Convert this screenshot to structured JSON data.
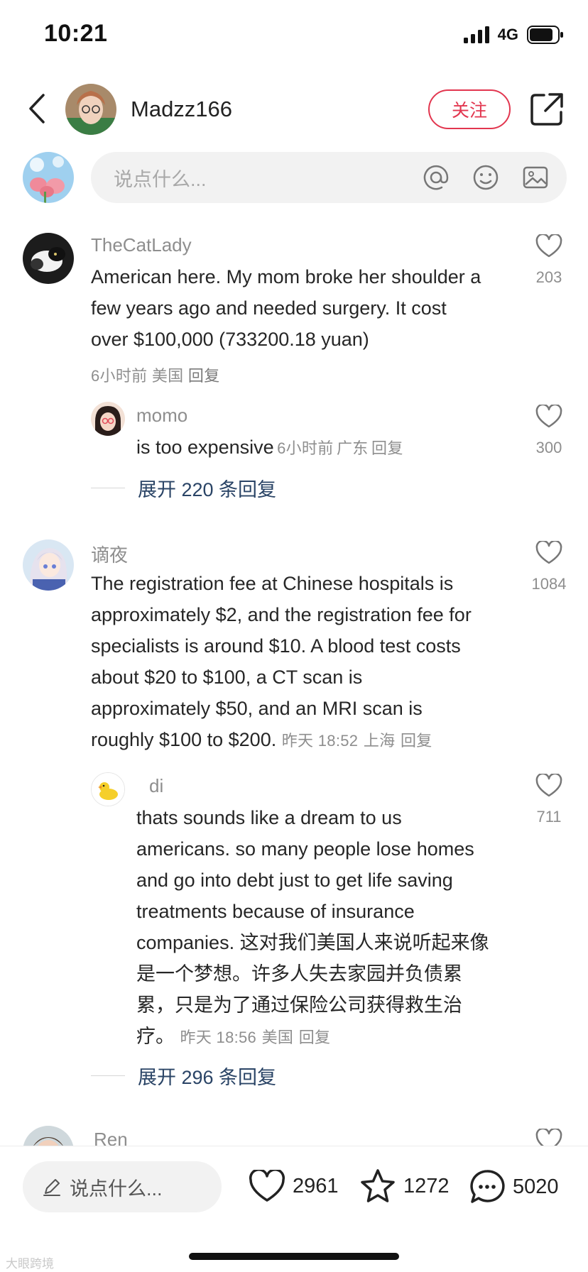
{
  "status": {
    "time": "10:21",
    "network": "4G"
  },
  "header": {
    "username": "Madzz166",
    "follow_label": "关注"
  },
  "compose": {
    "placeholder": "说点什么..."
  },
  "comments": [
    {
      "user": "TheCatLady",
      "text_lines": [
        "American here. My mom broke her shoulder a",
        "few years ago and needed surgery. It cost",
        "over $100,000 (733200.18 yuan)"
      ],
      "time": "6小时前",
      "location": "美国",
      "reply_label": "回复",
      "likes": "203",
      "replies": [
        {
          "user": "momo",
          "text": "is too expensive",
          "time": "6小时前",
          "location": "广东",
          "reply_label": "回复",
          "likes": "300"
        }
      ],
      "expand_label": "展开 220 条回复"
    },
    {
      "user": "谪夜",
      "text_lines": [
        "The registration fee at Chinese hospitals is",
        "approximately $2, and the registration fee for",
        "specialists is around $10. A blood test costs",
        "about $20 to $100, a CT scan is",
        "approximately $50, and an MRI scan is",
        "roughly $100 to $200."
      ],
      "time": "昨天 18:52",
      "location": "上海",
      "reply_label": "回复",
      "likes": "1084",
      "replies": [
        {
          "user": "di",
          "text_lines": [
            "thats sounds like a dream to us",
            "americans. so many people lose homes",
            "and go into debt just to get life saving",
            "treatments because of insurance",
            "companies. 这对我们美国人来说听起来像",
            "是一个梦想。许多人失去家园并负债累",
            "累，只是为了通过保险公司获得救生治",
            "疗。"
          ],
          "time": "昨天 18:56",
          "location": "美国",
          "reply_label": "回复",
          "likes": "711"
        }
      ],
      "expand_label": "展开 296 条回复"
    },
    {
      "user": "Ren"
    }
  ],
  "bottom": {
    "placeholder": "说点什么...",
    "likes": "2961",
    "favorites": "1272",
    "comments": "5020"
  },
  "watermark": "大眼跨境"
}
